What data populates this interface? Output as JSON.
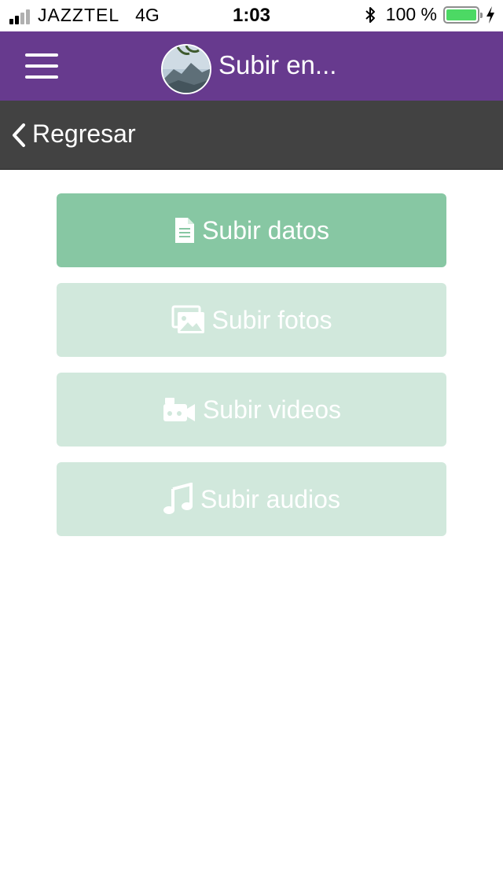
{
  "status_bar": {
    "carrier": "JAZZTEL",
    "network": "4G",
    "time": "1:03",
    "battery_percent": "100 %",
    "battery_level": 1.0,
    "colors": {
      "battery_fill": "#4cd964",
      "signal_active": "#000000",
      "signal_inactive": "#b0b0b0"
    }
  },
  "header": {
    "title": "Subir en...",
    "menu_icon": "hamburger-icon",
    "background": "#673a8e"
  },
  "back_bar": {
    "label": "Regresar",
    "icon": "chevron-left-icon",
    "background": "#424242"
  },
  "actions": [
    {
      "label": "Subir datos",
      "icon": "document-icon",
      "state": "enabled",
      "color": "#87c7a3"
    },
    {
      "label": "Subir fotos",
      "icon": "photos-icon",
      "state": "disabled",
      "color": "#d1e8dc"
    },
    {
      "label": "Subir videos",
      "icon": "video-camera-icon",
      "state": "disabled",
      "color": "#d1e8dc"
    },
    {
      "label": "Subir audios",
      "icon": "music-note-icon",
      "state": "disabled",
      "color": "#d1e8dc"
    }
  ]
}
